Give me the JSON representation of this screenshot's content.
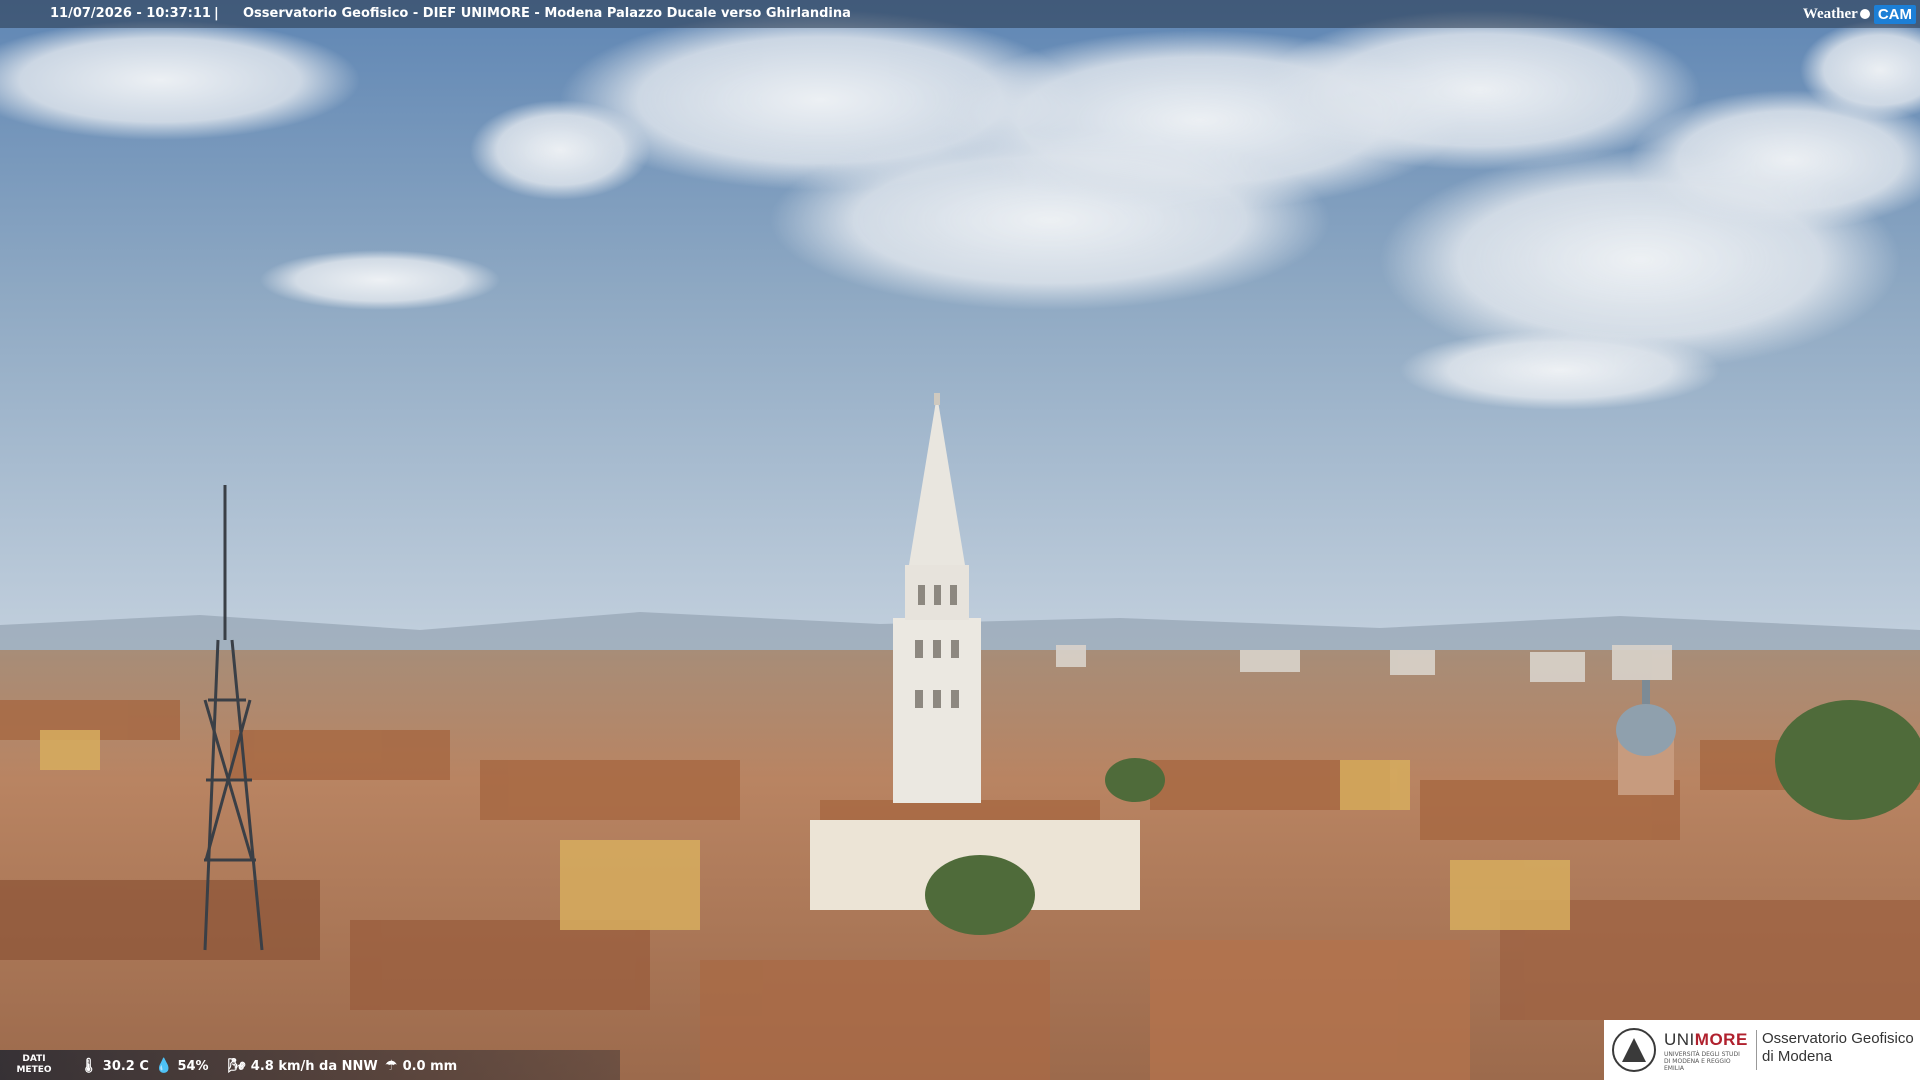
{
  "overlay": {
    "timestamp": "11/07/2026 - 10:37:11",
    "separator": "|",
    "title": "Osservatorio Geofisico - DIEF UNIMORE - Modena Palazzo Ducale verso Ghirlandina",
    "brand_weather": "Weather",
    "brand_cam": "CAM"
  },
  "meteo": {
    "label_line1": "DATI",
    "label_line2": "METEO",
    "temperature": "30.2 C",
    "humidity": "54%",
    "wind": "4.8 km/h da NNW",
    "rain": "0.0 mm",
    "icons": [
      "thermometer-icon",
      "humidity-icon",
      "wind-icon",
      "rain-gauge-icon"
    ]
  },
  "logo": {
    "uni_prefix": "UNI",
    "uni_suffix": "MORE",
    "uni_sub": "UNIVERSITÀ DEGLI STUDI DI MODENA E REGGIO EMILIA",
    "obs_line1": "Osservatorio Geofisico",
    "obs_line2": "di Modena"
  },
  "colors": {
    "sky_top": "#5f86b4",
    "sky_horizon": "#c4d1de",
    "roof": "#b97a55",
    "tower": "#e9e6df",
    "unimore_red": "#b0212e",
    "cam_blue": "#1c7fd6"
  }
}
